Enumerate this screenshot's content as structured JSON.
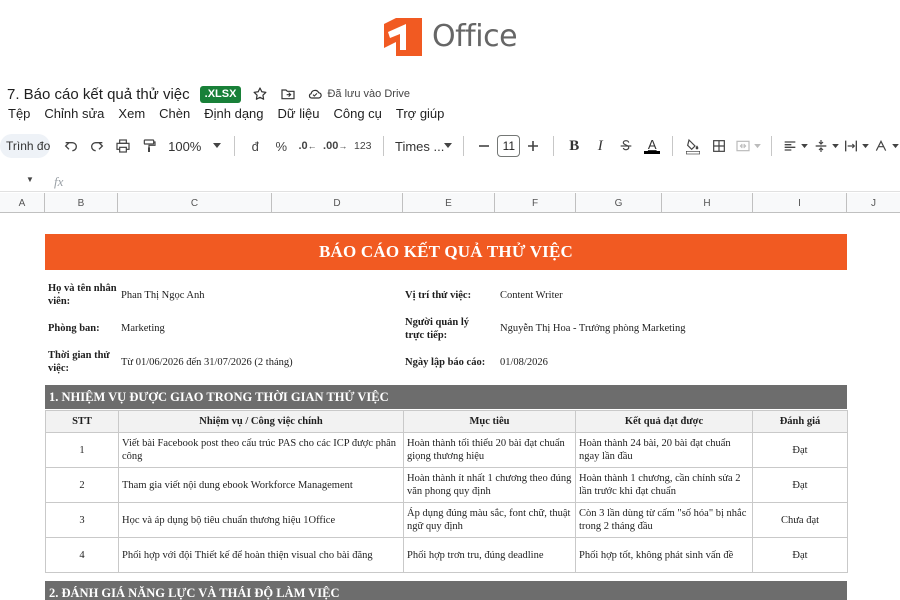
{
  "logo": {
    "text": "Office"
  },
  "doc": {
    "title": "7. Báo cáo kết quả thử việc",
    "format_badge": ".XLSX",
    "saved_status": "Đã lưu vào Drive"
  },
  "menu": [
    "Tệp",
    "Chỉnh sửa",
    "Xem",
    "Chèn",
    "Định dạng",
    "Dữ liệu",
    "Công cụ",
    "Trợ giúp"
  ],
  "toolbar": {
    "search_label": "Trình đơn",
    "zoom": "100%",
    "currency": "đ",
    "percent": "%",
    "dec_decrease": ".0",
    "dec_increase": ".00",
    "number_format": "123",
    "font": "Times ...",
    "font_size": "11",
    "bold": "B",
    "italic": "I",
    "text_color_letter": "A"
  },
  "formula_bar": {
    "fx": "fx"
  },
  "columns": [
    "A",
    "B",
    "C",
    "D",
    "E",
    "F",
    "G",
    "H",
    "I",
    "J"
  ],
  "report": {
    "title": "BÁO CÁO KẾT QUẢ THỬ VIỆC",
    "info": {
      "name_label": "Họ và tên nhân viên:",
      "name_value": "Phan Thị Ngọc Anh",
      "position_label": "Vị trí thử việc:",
      "position_value": "Content Writer",
      "department_label": "Phòng ban:",
      "department_value": "Marketing",
      "manager_label": "Người quản lý trực tiếp:",
      "manager_value": "Nguyễn Thị Hoa - Trưởng phòng Marketing",
      "period_label": "Thời gian thử việc:",
      "period_value": "Từ 01/06/2026 đến 31/07/2026 (2 tháng)",
      "report_date_label": "Ngày lập báo cáo:",
      "report_date_value": "01/08/2026"
    },
    "section1_title": "1. NHIỆM VỤ ĐƯỢC GIAO TRONG THỜI GIAN THỬ VIỆC",
    "table_headers": [
      "STT",
      "Nhiệm vụ / Công việc chính",
      "Mục tiêu",
      "Kết quả đạt được",
      "Đánh giá"
    ],
    "tasks": [
      [
        "1",
        "Viết bài Facebook post theo cấu trúc PAS cho các ICP được phân công",
        "Hoàn thành tối thiểu 20 bài đạt chuẩn giọng thương hiệu",
        "Hoàn thành 24 bài, 20 bài đạt chuẩn ngay lần đầu",
        "Đạt"
      ],
      [
        "2",
        "Tham gia viết nội dung ebook Workforce Management",
        "Hoàn thành ít nhất 1 chương theo đúng văn phong quy định",
        "Hoàn thành 1 chương, cần chỉnh sửa 2 lần trước khi đạt chuẩn",
        "Đạt"
      ],
      [
        "3",
        "Học và áp dụng bộ tiêu chuẩn thương hiệu 1Office",
        "Áp dụng đúng màu sắc, font chữ, thuật ngữ quy định",
        "Còn 3 lần dùng từ cấm \"số hóa\" bị nhắc trong 2 tháng đầu",
        "Chưa đạt"
      ],
      [
        "4",
        "Phối hợp với đội Thiết kế để hoàn thiện visual cho bài đăng",
        "Phối hợp trơn tru, đúng deadline",
        "Phối hợp tốt, không phát sinh vấn đề",
        "Đạt"
      ]
    ],
    "section2_title": "2. ĐÁNH GIÁ NĂNG LỰC VÀ THÁI ĐỘ LÀM VIỆC"
  },
  "colors": {
    "brand_orange": "#f15a22",
    "section_gray": "#6d6d6d",
    "xlsx_green": "#188038"
  }
}
